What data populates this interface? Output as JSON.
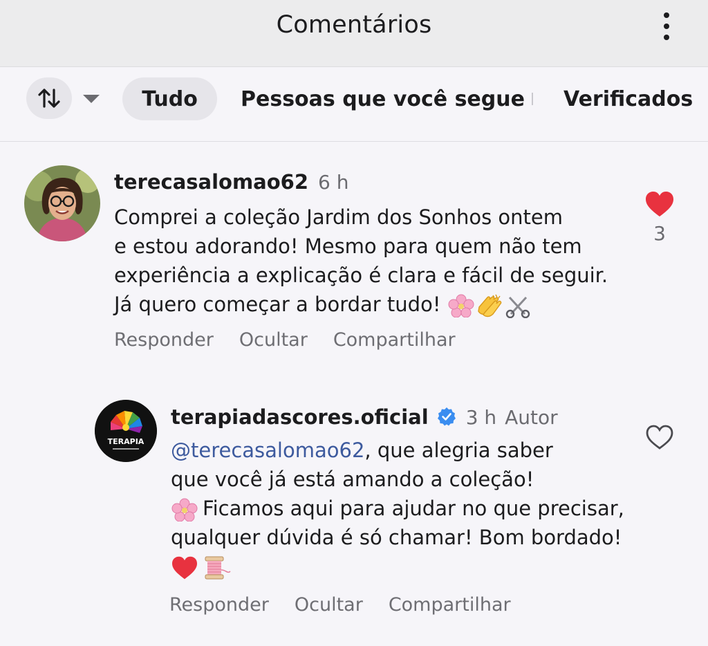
{
  "header": {
    "title": "Comentários"
  },
  "filters": {
    "chips": [
      "Tudo",
      "Pessoas que você segue",
      "Verificados"
    ],
    "active": "Tudo"
  },
  "comments": [
    {
      "username": "terecasalomao62",
      "time": "6 h",
      "lines": [
        "Comprei a coleção Jardim dos Sonhos ontem",
        "e estou adorando! Mesmo para quem não tem",
        "experiência a explicação é clara e fácil de seguir.",
        "Já quero começar a bordar tudo!"
      ],
      "likes": "3",
      "liked": true,
      "actions": [
        "Responder",
        "Ocultar",
        "Compartilhar"
      ]
    },
    {
      "username": "terapiadascores.oficial",
      "time": "3 h",
      "author_label": "Autor",
      "mention": "@terecasalomao62",
      "lines": [
        ", que alegria saber",
        "que você já está amando a coleção!",
        "Ficamos aqui para ajudar no que precisar,",
        "qualquer dúvida é só chamar! Bom bordado!"
      ],
      "avatar_logo_text": "TERAPIA",
      "liked": false,
      "actions": [
        "Responder",
        "Ocultar",
        "Compartilhar"
      ]
    }
  ],
  "icons": {
    "like_filled_color": "#e8323f",
    "verified_color": "#3a8df0"
  }
}
